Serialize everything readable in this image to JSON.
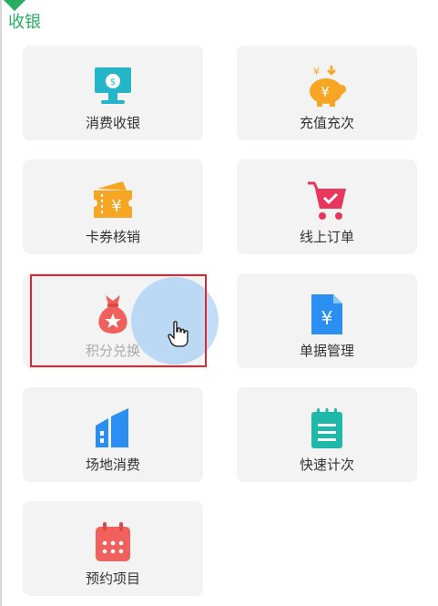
{
  "section": {
    "title": "收银"
  },
  "colors": {
    "accent": "#27ae60",
    "highlight": "#e5232a",
    "ripple": "#8cc3f5"
  },
  "tiles": [
    {
      "label": "消费收银",
      "icon": "money-bag-monitor-icon"
    },
    {
      "label": "充值充次",
      "icon": "piggy-bank-yen-icon"
    },
    {
      "label": "卡券核销",
      "icon": "coupon-ticket-icon"
    },
    {
      "label": "线上订单",
      "icon": "shopping-cart-icon"
    },
    {
      "label": "积分兑换",
      "icon": "star-money-bag-icon",
      "selected": true
    },
    {
      "label": "单据管理",
      "icon": "yen-document-icon"
    },
    {
      "label": "场地消费",
      "icon": "building-icon"
    },
    {
      "label": "快速计次",
      "icon": "notepad-icon"
    },
    {
      "label": "预约项目",
      "icon": "calendar-icon"
    }
  ]
}
